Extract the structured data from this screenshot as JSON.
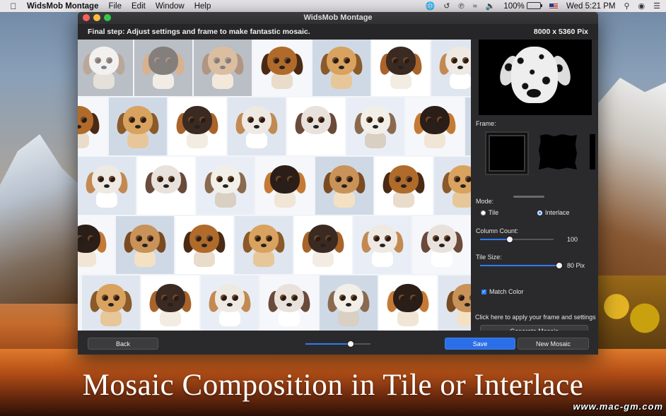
{
  "menubar": {
    "app_name": "WidsMob Montage",
    "menus": [
      "File",
      "Edit",
      "Window",
      "Help"
    ],
    "battery": "100%",
    "clock": "Wed 5:21 PM"
  },
  "window": {
    "title": "WidsMob Montage",
    "step_message": "Final step: Adjust settings and frame to make fantastic mosaic.",
    "dimensions": "8000 x 5360 Pix"
  },
  "panel": {
    "frame_label": "Frame:",
    "mode_label": "Mode:",
    "mode_options": [
      "Tile",
      "Interlace"
    ],
    "mode_selected": "Interlace",
    "column_count_label": "Column Count:",
    "column_count_value": "100",
    "column_count_fraction": 0.4,
    "tile_size_label": "Tile Size:",
    "tile_size_value": "80 Pix",
    "tile_size_fraction": 0.98,
    "match_color_label": "Match Color",
    "match_color_checked": true,
    "apply_hint": "Click here to apply your frame and settings",
    "generate_label": "Generate Mosaic"
  },
  "toolbar": {
    "back_label": "Back",
    "zoom_fraction": 0.7,
    "save_label": "Save",
    "new_mosaic_label": "New Mosaic"
  },
  "colors": {
    "accent": "#2b6fe8",
    "window_bg": "#262628",
    "panel_bg": "#2a2a2c"
  },
  "caption": "Mosaic Composition in Tile or Interlace",
  "watermark": "www.mac-gm.com"
}
